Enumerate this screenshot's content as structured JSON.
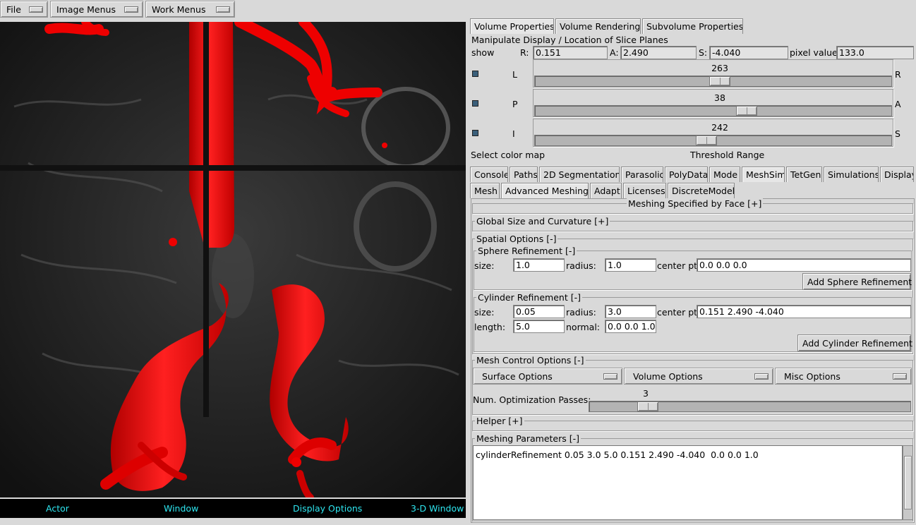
{
  "menubar": {
    "file": "File",
    "image_menus": "Image Menus",
    "work_menus": "Work Menus"
  },
  "viewer": {
    "footer": {
      "actor": "Actor",
      "window": "Window",
      "display_options": "Display Options",
      "window3d": "3-D Window"
    }
  },
  "top_tabs": [
    "Volume Properties",
    "Volume Rendering",
    "Subvolume Properties"
  ],
  "slice_panel": {
    "title": "Manipulate Display / Location of Slice Planes",
    "show_label": "show",
    "r_label": "R:",
    "r_value": "0.151",
    "a_label": "A:",
    "a_value": "2.490",
    "s_label": "S:",
    "s_value": "-4.040",
    "pixel_label": "pixel value:",
    "pixel_value": "133.0",
    "sliders": [
      {
        "left": "L",
        "right": "R",
        "value": "263",
        "fraction": 0.52
      },
      {
        "left": "P",
        "right": "A",
        "value": "38",
        "fraction": 0.6
      },
      {
        "left": "I",
        "right": "S",
        "value": "242",
        "fraction": 0.48
      }
    ],
    "color_map_label": "Select color map",
    "threshold_label": "Threshold Range"
  },
  "module_tabs": [
    "Console",
    "Paths",
    "2D Segmentation",
    "Parasolid",
    "PolyData",
    "Mode",
    "MeshSim",
    "TetGen",
    "Simulations",
    "Display"
  ],
  "meshsim_tabs": [
    "Mesh",
    "Advanced Meshing",
    "Adapt",
    "Licenses",
    "DiscreteModel"
  ],
  "advanced": {
    "meshing_by_face": "Meshing Specified by Face [+]",
    "global_size": "Global Size and Curvature [+]",
    "spatial_options": "Spatial Options [-]",
    "sphere": {
      "title": "Sphere Refinement [-]",
      "size_label": "size:",
      "size_value": "1.0",
      "radius_label": "radius:",
      "radius_value": "1.0",
      "center_label": "center pt:",
      "center_value": "0.0 0.0 0.0",
      "add_button": "Add Sphere Refinement"
    },
    "cylinder": {
      "title": "Cylinder Refinement [-]",
      "size_label": "size:",
      "size_value": "0.05",
      "radius_label": "radius:",
      "radius_value": "3.0",
      "center_label": "center pt:",
      "center_value": "0.151 2.490 -4.040",
      "length_label": "length:",
      "length_value": "5.0",
      "normal_label": "normal:",
      "normal_value": "0.0 0.0 1.0",
      "add_button": "Add Cylinder Refinement"
    },
    "mesh_control": {
      "title": "Mesh Control Options [-]",
      "surface": "Surface Options",
      "volume": "Volume Options",
      "misc": "Misc Options",
      "passes_label": "Num. Optimization Passes:",
      "passes_value": "3",
      "passes_fraction": 0.16
    },
    "helper": "Helper [+]",
    "meshing_params": "Meshing Parameters [-]",
    "params_text": "cylinderRefinement 0.05 3.0 5.0 0.151 2.490 -4.040  0.0 0.0 1.0"
  },
  "colors": {
    "vessel": "#ff0000",
    "footer_text": "#2ee6f0",
    "background": "#d9d9d9"
  }
}
